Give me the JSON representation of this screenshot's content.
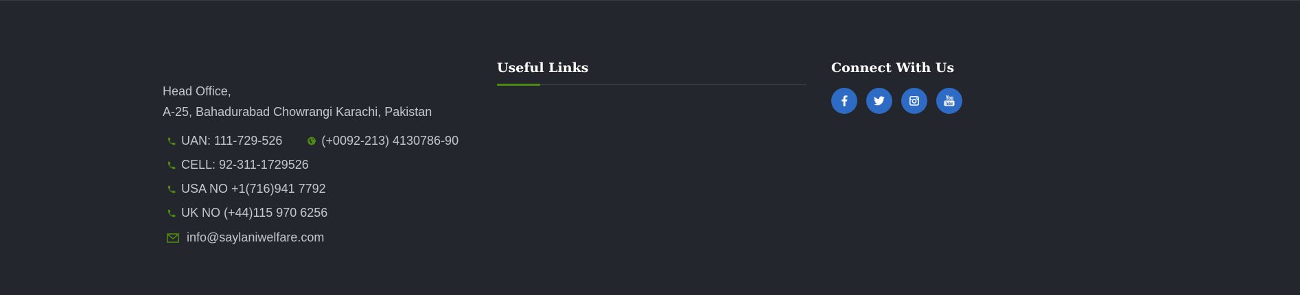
{
  "contact": {
    "address_line1": "Head Office,",
    "address_line2": "A-25, Bahadurabad Chowrangi Karachi, Pakistan",
    "uan": "UAN: 111-729-526",
    "fax": "(+0092-213) 4130786-90",
    "cell": "CELL: 92-311-1729526",
    "usa": "USA NO +1(716)941 7792",
    "uk": "UK NO (+44)115 970 6256",
    "email": "info@saylaniwelfare.com",
    "icon_color": "#4f8a10"
  },
  "useful_links": {
    "heading": "Useful Links",
    "accent_color": "#4f8a10"
  },
  "connect": {
    "heading": "Connect With Us",
    "button_color": "#2e6bc4",
    "icons": [
      "facebook-icon",
      "twitter-icon",
      "instagram-icon",
      "youtube-icon"
    ]
  },
  "colors": {
    "background": "#24262d",
    "text": "#c3c6cc",
    "heading": "#ffffff"
  }
}
